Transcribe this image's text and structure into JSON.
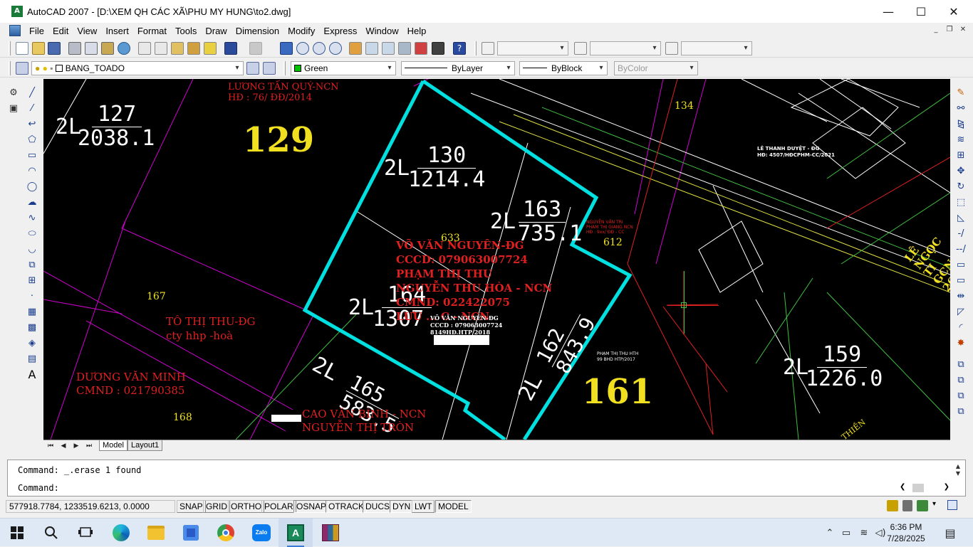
{
  "window": {
    "title": "AutoCAD 2007 - [D:\\XEM QH CÁC XÃ\\PHU MY HUNG\\to2.dwg]",
    "app_icon_glyph": "A",
    "controls": {
      "minimize": "—",
      "maximize": "☐",
      "close": "✕"
    },
    "doc_controls": {
      "minimize": "_",
      "restore": "❐",
      "close": "✕"
    }
  },
  "menu": [
    "File",
    "Edit",
    "View",
    "Insert",
    "Format",
    "Tools",
    "Draw",
    "Dimension",
    "Modify",
    "Express",
    "Window",
    "Help"
  ],
  "properties_toolbar": {
    "layer": "BANG_TOADO",
    "color": "Green",
    "color_hex": "#00c000",
    "linetype": "ByLayer",
    "lineweight": "ByBlock",
    "plotstyle": "ByColor"
  },
  "layout_tabs": {
    "model": "Model",
    "layout1": "Layout1"
  },
  "command": {
    "history": "Command: _.erase 1 found",
    "prompt": "Command:"
  },
  "status": {
    "coordinates": "577918.7784, 1233519.6213, 0.0000",
    "toggles": [
      "SNAP",
      "GRID",
      "ORTHO",
      "POLAR",
      "OSNAP",
      "OTRACK",
      "DUCS",
      "DYN",
      "LWT",
      "MODEL"
    ]
  },
  "taskbar": {
    "apps": [
      "start-icon",
      "search-icon",
      "task-view-icon",
      "edge-icon",
      "file-explorer-icon",
      "store-icon",
      "chrome-icon",
      "zalo-icon",
      "autocad-icon",
      "winrar-icon"
    ],
    "zalo_label": "Zalo",
    "time": "6:36 PM",
    "date": "7/28/2025"
  },
  "drawing": {
    "labels": {
      "owner_luong": "LƯƠNG TẤN QUÝ-NCN",
      "owner_luong_hd": "HĐ : 76/ ĐĐ/2014",
      "parcel_129": "129",
      "parcel_127_lot": "2L",
      "parcel_127_num": "127",
      "parcel_127_area": "2038.1",
      "parcel_130_lot": "2L",
      "parcel_130_num": "130",
      "parcel_130_area": "1214.4",
      "parcel_163_lot": "2L",
      "parcel_163_num": "163",
      "parcel_163_area": "735.1",
      "parcel_164_lot": "2L",
      "parcel_164_num": "164",
      "parcel_164_area": "1307",
      "parcel_165_lot": "2L",
      "parcel_165_num": "165",
      "parcel_165_area": "583.5",
      "parcel_162_lot": "2L",
      "parcel_162_num": "162",
      "parcel_162_area": "843.9",
      "parcel_159_lot": "2L",
      "parcel_159_num": "159",
      "parcel_159_area": "1226.0",
      "num_633": "633",
      "num_612": "612",
      "num_134": "134",
      "num_167": "167",
      "num_168": "168",
      "parcel_161": "161",
      "owner_vo": "VÕ VĂN NGUYÊN-ĐG",
      "owner_vo_cccd": "CCCD: 079063007724",
      "owner_pham": "PHẠM THỊ THU",
      "owner_nguyen_hoa": "NGUYỄN THU HÒA - NCN",
      "owner_nguyen_cmnd": "CMND: 022422075",
      "owner_luu": "LƯU ... C - NCN",
      "small_vo": "VÕ VĂN NGUYÊN-ĐG",
      "small_vo_cccd": "CCCD : 079063007724",
      "small_vo_hd": "8149HĐ.HTP/2018",
      "owner_to": "TÔ THỊ THU-ĐG",
      "owner_to_cty": "cty hhp -hoà",
      "owner_duong": "DƯƠNG VĂN MINH",
      "owner_duong_cmnd": "CMND : 021790385",
      "owner_cao": "CAO VĂN BÌNH - NCN",
      "owner_nguyen_tron": "NGUYỄN THỊ TRÒN",
      "owner_le_thanh": "LÊ THANH DUYỆT - ĐG",
      "owner_le_thanh_hd": "HĐ: 4507/HĐCPHM-CC/2021",
      "owner_le_ngoc": "LÊ NGỌC TI",
      "owner_le_ngoc_gcn": "GCN01",
      "owner_le_ngoc_date": "26-5-02",
      "owner_pham_thu": "PHẠM THỊ THU HTH",
      "owner_pham_thu_hd": "99 BHD HTP/2017",
      "owner_nguyen_van_tri": "NGUYỄN VĂN TRI",
      "owner_nguyen_van_tri_2": "PHẠM THỊ GIANG NCN",
      "owner_nguyen_van_tri_3": "HĐ : 9xx/ ĐĐ - CC",
      "road_label": "THIỀN"
    }
  }
}
